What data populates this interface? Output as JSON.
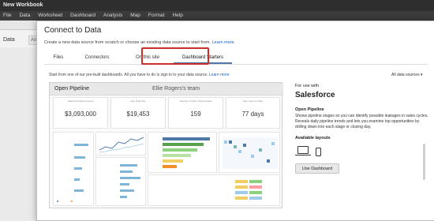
{
  "app": {
    "window_title": "New Workbook",
    "menu": [
      "File",
      "Data",
      "Worksheet",
      "Dashboard",
      "Analysis",
      "Map",
      "Format",
      "Help"
    ],
    "side_data_label": "Data",
    "side_tab_label": "Analytics"
  },
  "dialog": {
    "title": "Connect to Data",
    "subtitle": "Create a new data source from scratch or choose an existing data source to start from.",
    "subtitle_link": "Learn more.",
    "tabs": [
      "Files",
      "Connectors",
      "On this site",
      "Dashboard Starters"
    ],
    "active_tab": "Dashboard Starters",
    "intro": "Start from one of our pre-built dashboards. All you have to do is sign in to your data source.",
    "intro_link": "Learn more",
    "filter": "All data sources ▾"
  },
  "thumbnail": {
    "dashboard_name": "Open Pipeline",
    "team": "Ellie Rogers's team",
    "kpis": [
      {
        "caption": "Total Forecasted Amount",
        "value": "$3,093,000"
      },
      {
        "caption": "Avg. Deal Size",
        "value": "$19,453"
      },
      {
        "caption": "Number of Open Opportunities",
        "value": "159"
      },
      {
        "caption": "Avg. Days to Close",
        "value": "77 days"
      }
    ]
  },
  "info": {
    "for_use_with": "For use with",
    "source": "Salesforce",
    "desc_title": "Open Pipeline",
    "description": "Shows pipeline stages so you can identify possible leakages in sales cycles. Reveals daily pipeline trends and lets you examine top opportunities by drilling down into each stage or closing day.",
    "layouts_title": "Available layouts",
    "use_button": "Use Dashboard"
  },
  "colors": {
    "highlight": "#c9302c",
    "link": "#1f5fbf",
    "accent": "#4e79a7"
  }
}
